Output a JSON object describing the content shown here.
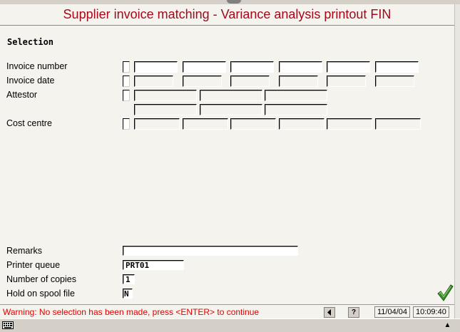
{
  "header": {
    "title": "Supplier invoice matching - Variance analysis printout FIN"
  },
  "selection": {
    "section_title": "Selection",
    "invoice_number_label": "Invoice number",
    "invoice_date_label": "Invoice date",
    "attestor_label": "Attestor",
    "cost_centre_label": "Cost centre"
  },
  "options": {
    "remarks_label": "Remarks",
    "remarks_value": "",
    "printer_queue_label": "Printer queue",
    "printer_queue_value": "PRT01",
    "copies_label": "Number of copies",
    "copies_value": "1",
    "hold_label": "Hold on spool file",
    "hold_value": "N"
  },
  "status": {
    "message": "Warning: No selection has been made, press <ENTER> to continue",
    "help": "?",
    "date": "11/04/04",
    "time": "10:09:40"
  },
  "colors": {
    "title": "#a3081b",
    "warning": "#e00000",
    "check": "#3d8f2a"
  }
}
